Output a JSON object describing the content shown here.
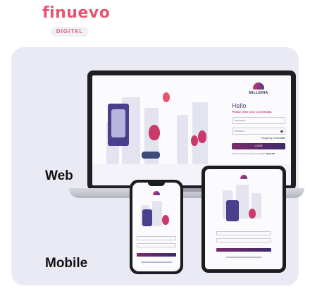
{
  "brand": {
    "name": "finuevo",
    "tag": "DIGITAL"
  },
  "labels": {
    "web": "Web",
    "mobile": "Mobile"
  },
  "app": {
    "logo": "MILLENIA",
    "greeting": "Hello",
    "prompt": "Please enter your Credentials.",
    "username_placeholder": "Username",
    "password_placeholder": "Password",
    "forgot": "Forgot my Credentials",
    "login_button": "LOGIN",
    "signup_prompt": "Don't you have an account already?",
    "signup_link": "SIGN UP"
  },
  "colors": {
    "brand": "#e8546f",
    "accent": "#d1346b",
    "card": "#e9eaf4"
  }
}
